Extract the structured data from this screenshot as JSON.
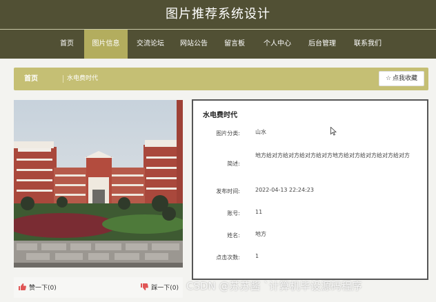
{
  "header": {
    "title": "图片推荐系统设计"
  },
  "nav": {
    "items": [
      {
        "label": "首页"
      },
      {
        "label": "图片信息"
      },
      {
        "label": "交流论坛"
      },
      {
        "label": "网站公告"
      },
      {
        "label": "留言板"
      },
      {
        "label": "个人中心"
      },
      {
        "label": "后台管理"
      },
      {
        "label": "联系我们"
      }
    ],
    "active_index": 1
  },
  "breadcrumb": {
    "home": "首页",
    "current": "水电费时代"
  },
  "collect": {
    "label": "点我收藏",
    "icon": "star-outline-icon"
  },
  "detail": {
    "title": "水电费时代",
    "fields": [
      {
        "label": "图片分类:",
        "value": "山水"
      },
      {
        "label": "简述:",
        "value": "地方给对方给对方给对方给对方地方给对方给对方给对方给对方"
      },
      {
        "label": "发布时间:",
        "value": "2022-04-13 22:24:23"
      },
      {
        "label": "账号:",
        "value": "11"
      },
      {
        "label": "姓名:",
        "value": "地方"
      },
      {
        "label": "点击次数:",
        "value": "1"
      }
    ]
  },
  "reactions": {
    "like": {
      "label": "赞一下(0)",
      "icon": "thumbs-up-icon"
    },
    "dislike": {
      "label": "踩一下(0)",
      "icon": "thumbs-down-icon"
    }
  },
  "watermark": {
    "text": "CSDN @苏苏酱  `计算机毕设源码程序"
  },
  "colors": {
    "header": "#515034",
    "accent": "#b3ad5e",
    "breadcrumb": "#c5bf74",
    "reaction_icon": "#e05555"
  }
}
